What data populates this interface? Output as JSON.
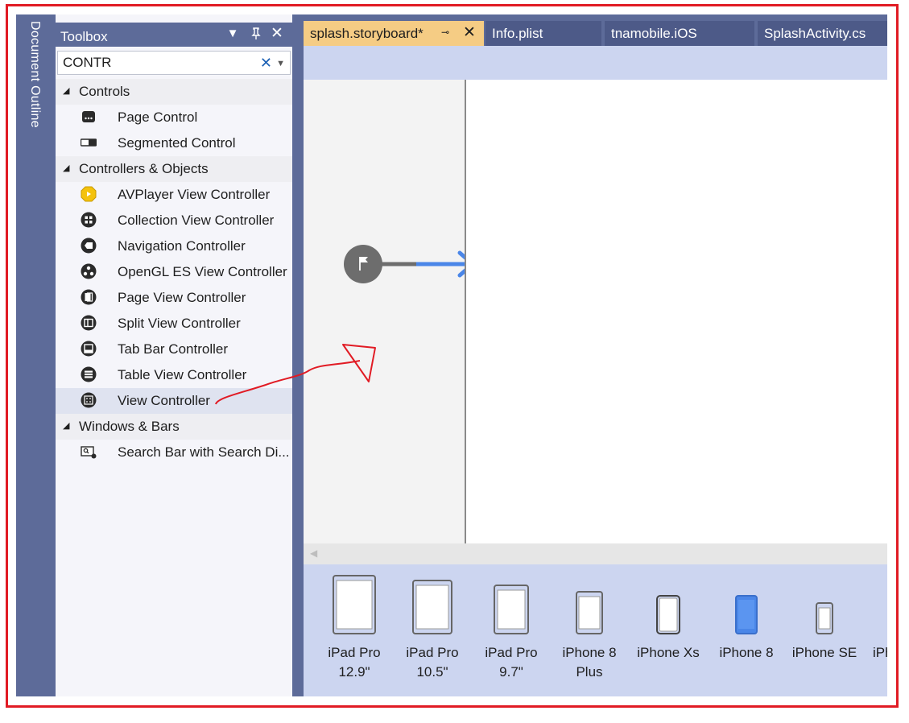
{
  "document_outline": {
    "label": "Document Outline"
  },
  "toolbox": {
    "title": "Toolbox",
    "search_value": "CONTR",
    "categories": [
      {
        "label": "Controls",
        "items": [
          {
            "label": "Page Control",
            "icon": "page-control-icon"
          },
          {
            "label": "Segmented Control",
            "icon": "segmented-control-icon"
          }
        ]
      },
      {
        "label": "Controllers & Objects",
        "items": [
          {
            "label": "AVPlayer View Controller",
            "icon": "avplayer-icon"
          },
          {
            "label": "Collection View Controller",
            "icon": "collection-view-icon"
          },
          {
            "label": "Navigation Controller",
            "icon": "navigation-controller-icon"
          },
          {
            "label": "OpenGL ES View Controller",
            "icon": "opengl-icon"
          },
          {
            "label": "Page View Controller",
            "icon": "page-view-icon"
          },
          {
            "label": "Split View Controller",
            "icon": "split-view-icon"
          },
          {
            "label": "Tab Bar Controller",
            "icon": "tab-bar-icon"
          },
          {
            "label": "Table View Controller",
            "icon": "table-view-icon"
          },
          {
            "label": "View Controller",
            "icon": "view-controller-icon",
            "selected": true
          }
        ]
      },
      {
        "label": "Windows & Bars",
        "items": [
          {
            "label": "Search Bar with Search Di...",
            "icon": "search-bar-icon"
          }
        ]
      }
    ]
  },
  "tabs": [
    {
      "label": "splash.storyboard*",
      "active": true
    },
    {
      "label": "Info.plist"
    },
    {
      "label": "tnamobile.iOS"
    },
    {
      "label": "SplashActivity.cs"
    }
  ],
  "devices": [
    {
      "line1": "iPad Pro",
      "line2": "12.9\""
    },
    {
      "line1": "iPad Pro",
      "line2": "10.5\""
    },
    {
      "line1": "iPad Pro",
      "line2": "9.7\""
    },
    {
      "line1": "iPhone 8",
      "line2": "Plus"
    },
    {
      "line1": "iPhone Xs",
      "line2": ""
    },
    {
      "line1": "iPhone 8",
      "line2": "",
      "selected": true
    },
    {
      "line1": "iPhone SE",
      "line2": ""
    },
    {
      "line1": "iPh",
      "line2": ""
    }
  ],
  "colors": {
    "ide_chrome": "#5d6b99",
    "active_tab": "#f5cc84",
    "device_strip": "#ccd5f0",
    "entry_arrow": "#4a86e8",
    "annotation": "#e11b24"
  }
}
